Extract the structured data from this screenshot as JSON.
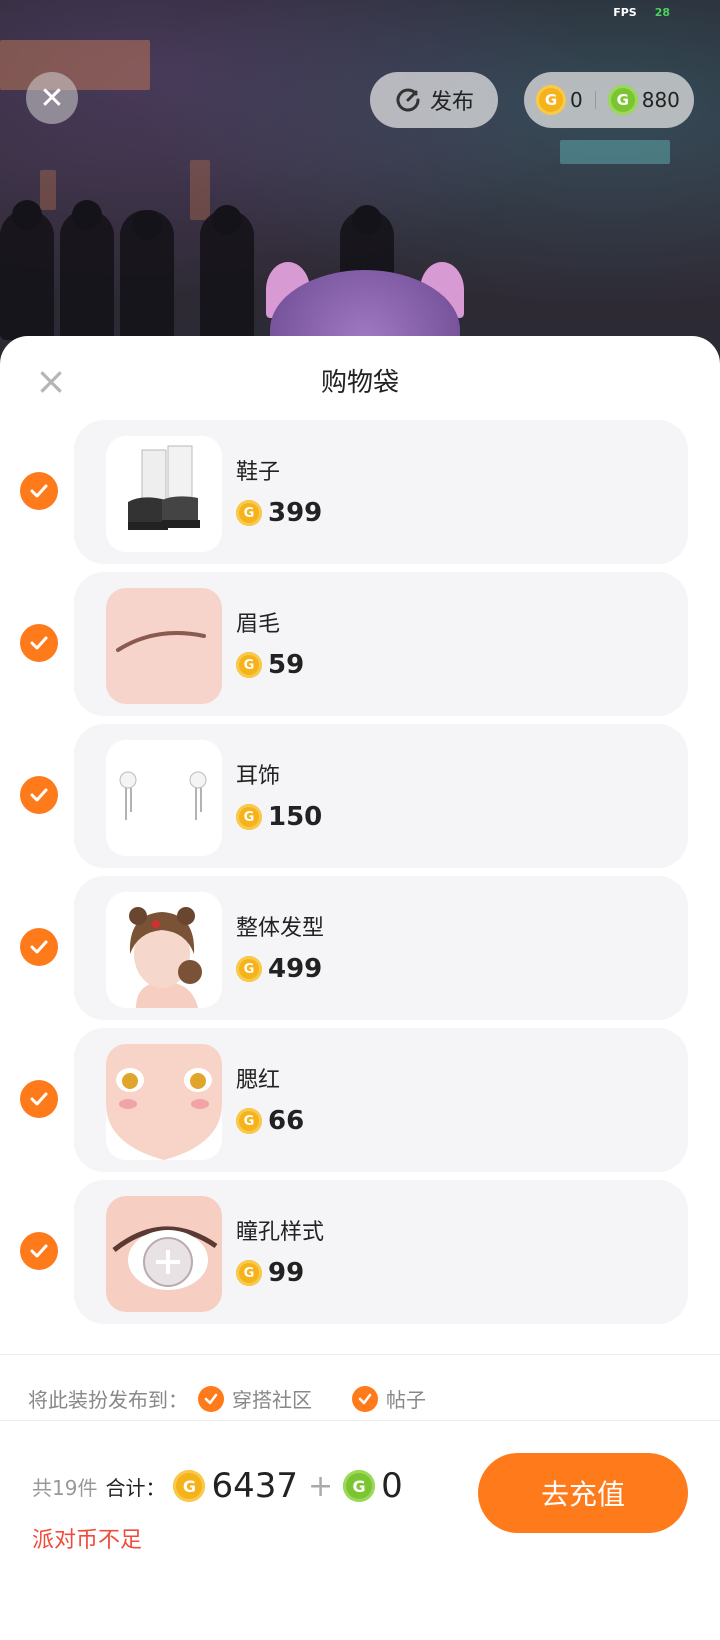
{
  "status": {
    "fps_label": "FPS",
    "fps_value": "28"
  },
  "top_bar": {
    "publish_label": "发布",
    "gold_balance": "0",
    "green_balance": "880"
  },
  "sheet": {
    "title": "购物袋",
    "items": [
      {
        "name": "鞋子",
        "price": "399",
        "checked": true,
        "thumb": "shoes"
      },
      {
        "name": "眉毛",
        "price": "59",
        "checked": true,
        "thumb": "eyebrow"
      },
      {
        "name": "耳饰",
        "price": "150",
        "checked": true,
        "thumb": "earrings"
      },
      {
        "name": "整体发型",
        "price": "499",
        "checked": true,
        "thumb": "hairstyle"
      },
      {
        "name": "腮红",
        "price": "66",
        "checked": true,
        "thumb": "blush"
      },
      {
        "name": "瞳孔样式",
        "price": "99",
        "checked": true,
        "thumb": "pupil"
      }
    ],
    "publish_to": {
      "label": "将此装扮发布到：",
      "options": [
        {
          "label": "穿搭社区",
          "checked": true
        },
        {
          "label": "帖子",
          "checked": true
        }
      ]
    },
    "footer": {
      "count_text": "共19件",
      "total_label": "合计：",
      "gold_total": "6437",
      "plus": "+",
      "green_total": "0",
      "warning": "派对币不足",
      "recharge_label": "去充值"
    }
  },
  "colors": {
    "accent": "#ff7a1a",
    "gold_coin": "#f5b21b",
    "green_coin": "#7cc532",
    "warning": "#f24b3c",
    "card_bg": "#f5f5f8"
  },
  "icons": {
    "close": "close-icon",
    "publish": "refresh-icon",
    "gold_coin": "gold-coin-icon",
    "green_coin": "green-coin-icon",
    "check": "check-icon"
  }
}
